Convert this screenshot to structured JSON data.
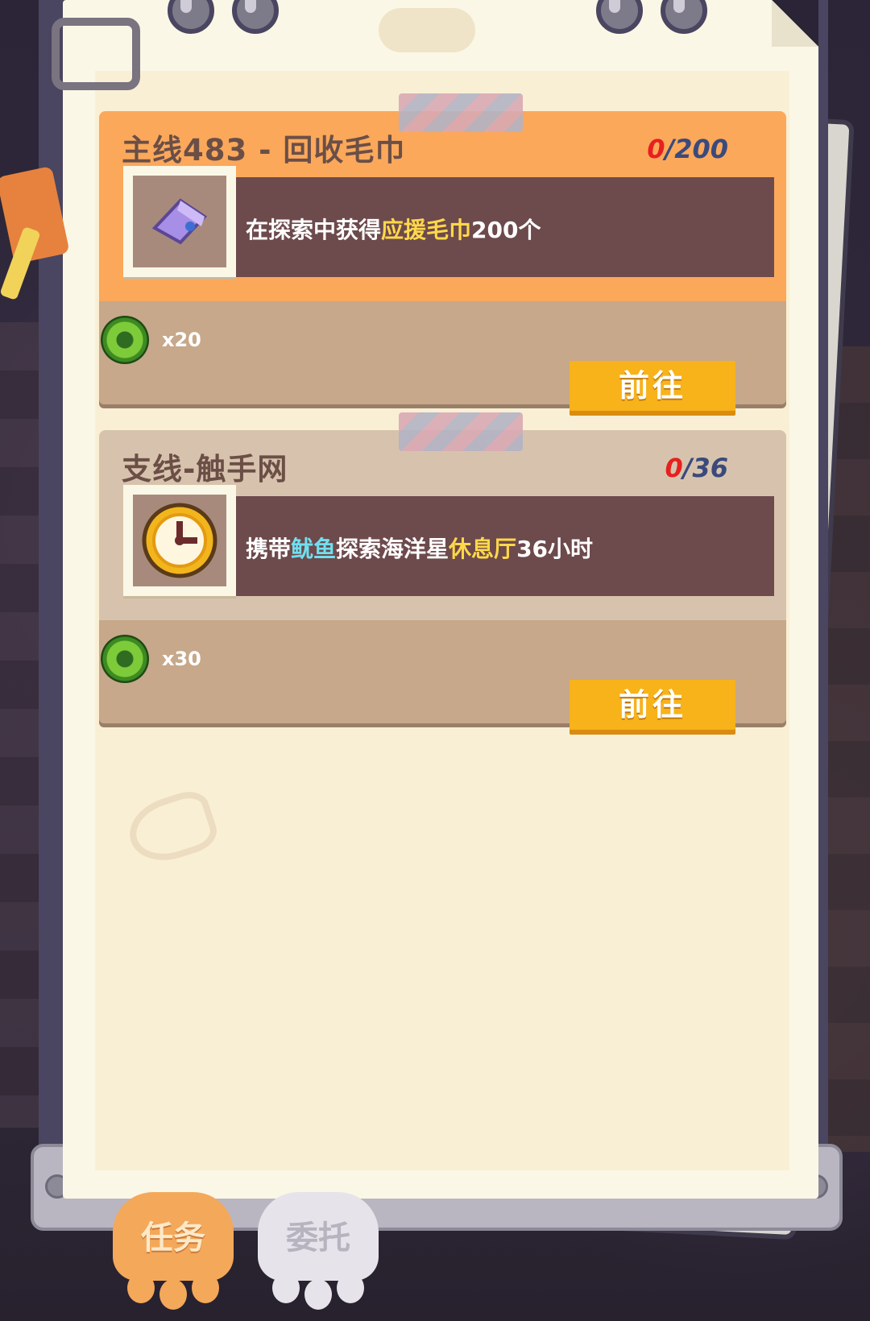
{
  "tasks": [
    {
      "title": "主线483 - 回收毛巾",
      "progress_current": "0",
      "progress_total": "/200",
      "desc_parts": [
        "在探索中获得",
        "应援毛巾",
        "200个"
      ],
      "reward_count": "x20",
      "go_label": "前往"
    },
    {
      "title": "支线-触手网",
      "progress_current": "0",
      "progress_total": "/36",
      "desc_parts": [
        "携带",
        "鱿鱼",
        "探索海洋星",
        "休息厅",
        "36小时"
      ],
      "reward_count": "x30",
      "go_label": "前往"
    }
  ],
  "tabs": [
    {
      "label": "任务",
      "active": true
    },
    {
      "label": "委托",
      "active": false
    }
  ],
  "colors": {
    "main_card": "#fba85b",
    "side_card": "#d7c3ad",
    "go_button": "#f8b21a",
    "progress_current": "#e81f1f"
  }
}
